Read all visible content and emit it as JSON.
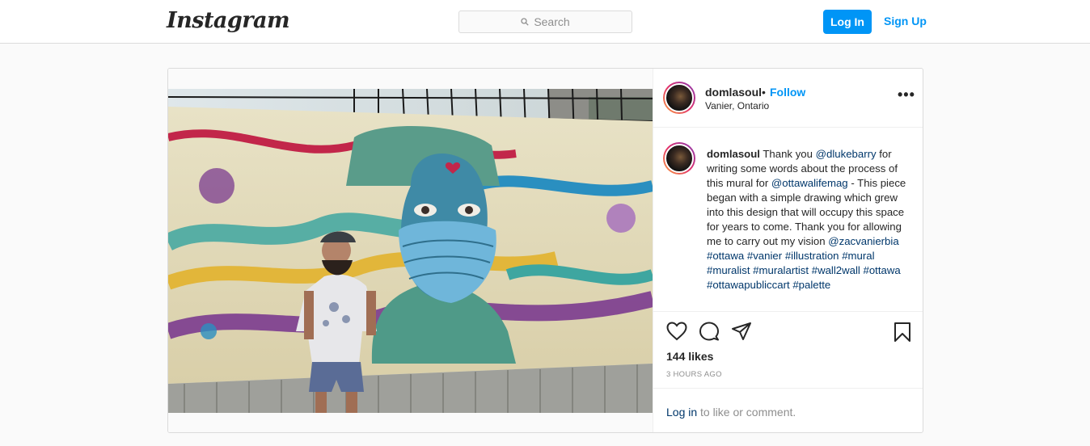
{
  "nav": {
    "logo": "Instagram",
    "search_placeholder": "Search",
    "login_label": "Log In",
    "signup_label": "Sign Up"
  },
  "post": {
    "username": "domlasoul",
    "separator": "•",
    "follow_label": "Follow",
    "location": "Vanier, Ontario",
    "more_label": "•••",
    "caption": {
      "username": "domlasoul",
      "segments": [
        {
          "text": " Thank you ",
          "link": false
        },
        {
          "text": "@dlukebarry",
          "link": true
        },
        {
          "text": " for writing some words about the process of this mural for ",
          "link": false
        },
        {
          "text": "@ottawalifemag",
          "link": true
        },
        {
          "text": " - This piece began with a simple drawing which grew into this design that will occupy this space for years to come. Thank you for allowing me to carry out my vision ",
          "link": false
        },
        {
          "text": "@zacvanierbia",
          "link": true
        },
        {
          "text": " ",
          "link": false
        },
        {
          "text": "#ottawa",
          "link": true
        },
        {
          "text": " ",
          "link": false
        },
        {
          "text": "#vanier",
          "link": true
        },
        {
          "text": " ",
          "link": false
        },
        {
          "text": "#illustration",
          "link": true
        },
        {
          "text": " ",
          "link": false
        },
        {
          "text": "#mural",
          "link": true
        },
        {
          "text": " ",
          "link": false
        },
        {
          "text": "#muralist",
          "link": true
        },
        {
          "text": " ",
          "link": false
        },
        {
          "text": "#muralartist",
          "link": true
        },
        {
          "text": " ",
          "link": false
        },
        {
          "text": "#wall2wall",
          "link": true
        },
        {
          "text": " ",
          "link": false
        },
        {
          "text": "#ottawa",
          "link": true
        },
        {
          "text": " ",
          "link": false
        },
        {
          "text": "#ottawapubliccart",
          "link": true
        },
        {
          "text": " ",
          "link": false
        },
        {
          "text": "#palette",
          "link": true
        }
      ]
    },
    "icons": {
      "like": "heart-icon",
      "comment": "comment-icon",
      "share": "paper-plane-icon",
      "save": "bookmark-icon"
    },
    "likes": "144 likes",
    "time": "3 HOURS AGO",
    "comment_login": "Log in",
    "comment_rest": "to like or comment."
  },
  "colors": {
    "accent": "#0095f6",
    "link": "#00376b",
    "muted": "#8e8e8e",
    "border": "#dbdbdb"
  }
}
